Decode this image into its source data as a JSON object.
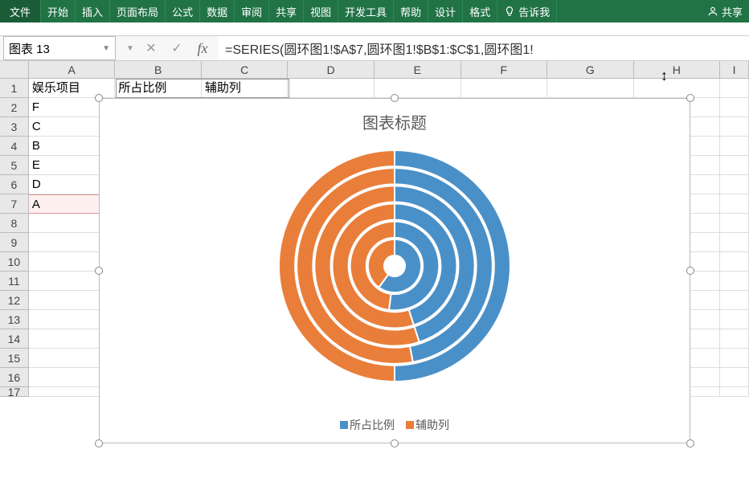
{
  "ribbon": {
    "tabs": [
      "文件",
      "开始",
      "插入",
      "页面布局",
      "公式",
      "数据",
      "审阅",
      "共享",
      "视图",
      "开发工具",
      "帮助",
      "设计",
      "格式"
    ],
    "tellme": "告诉我",
    "share": "共享"
  },
  "nameBox": "图表 13",
  "formula": "=SERIES(圆环图1!$A$7,圆环图1!$B$1:$C$1,圆环图1!",
  "columns": [
    "A",
    "B",
    "C",
    "D",
    "E",
    "F",
    "G",
    "H",
    "I"
  ],
  "rowHeaders": [
    "1",
    "2",
    "3",
    "4",
    "5",
    "6",
    "7",
    "8",
    "9",
    "10",
    "11",
    "12",
    "13",
    "14",
    "15",
    "16",
    "17"
  ],
  "cells": {
    "A1": "娱乐项目",
    "B1": "所占比例",
    "C1": "辅助列",
    "A2": "F",
    "A3": "C",
    "A4": "B",
    "A5": "E",
    "A6": "D",
    "A7": "A"
  },
  "chart": {
    "title": "图表标题",
    "legend": [
      "所占比例",
      "辅助列"
    ]
  },
  "chart_data": {
    "type": "doughnut",
    "title": "图表标题",
    "categories": [
      "F",
      "C",
      "B",
      "E",
      "D",
      "A"
    ],
    "series": [
      {
        "name": "所占比例",
        "values": [
          0.5,
          0.53,
          0.55,
          0.55,
          0.48,
          0.4
        ],
        "color": "#e97e3a"
      },
      {
        "name": "辅助列",
        "values": [
          0.5,
          0.47,
          0.45,
          0.45,
          0.52,
          0.6
        ],
        "color": "#4a90c8"
      }
    ],
    "note": "Concentric doughnut rings; each ring sums to 1. Rings from outer→inner follow categories F→A. Series 所占比例 (orange) starts at 12 o'clock going counter-clockwise; 辅助列 (blue) fills remainder clockwise.",
    "legend_position": "bottom"
  }
}
